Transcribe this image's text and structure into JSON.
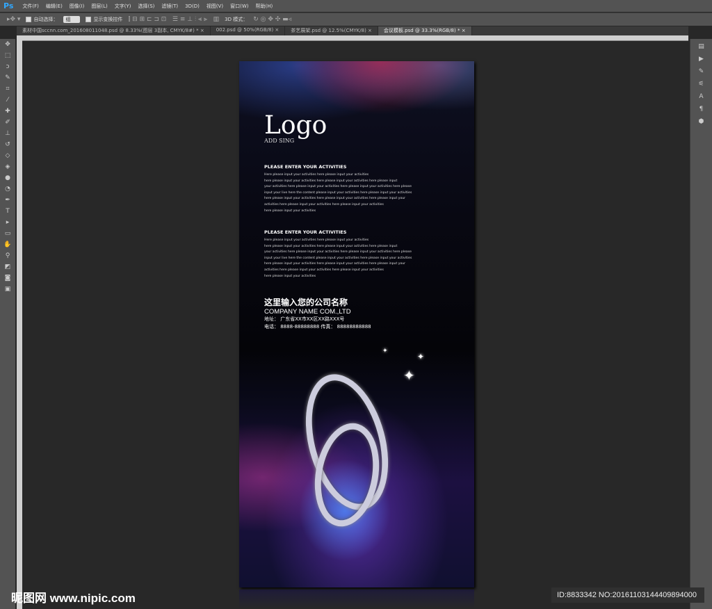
{
  "app": {
    "logo": "Ps"
  },
  "menu": [
    "文件(F)",
    "编辑(E)",
    "图像(I)",
    "图层(L)",
    "文字(Y)",
    "选择(S)",
    "滤镜(T)",
    "3D(D)",
    "视图(V)",
    "窗口(W)",
    "帮助(H)"
  ],
  "options": {
    "auto_select_label": "自动选择：",
    "auto_select_value": "组",
    "show_transform_label": "显示变换控件",
    "mode_3d_label": "3D 模式："
  },
  "tabs": [
    {
      "label": "素材中国sccnn.com_201608011048.psd @ 8.33%(图层 3副本, CMYK/8#) *",
      "close": "×"
    },
    {
      "label": "002.psd @ 50%(RGB/8)",
      "close": "×"
    },
    {
      "label": "茶艺展架.psd @ 12.5%(CMYK/8)",
      "close": "×"
    },
    {
      "label": "会议模板.psd @ 33.3%(RGB/8) *",
      "close": "×",
      "active": true
    }
  ],
  "poster": {
    "logo": "Logo",
    "logo_sub": "ADD SING",
    "sections": [
      {
        "heading": "PLEASE ENTER YOUR ACTIVITIES",
        "lines": [
          "Here please input your activities here please input your activities",
          "here please input your activities here please input your activities here please input",
          "your activities here please input your activities here please input your activities here please",
          "input your live here the content please input your activities here please input your activities",
          "here please input your activities here please input your activities here please input your",
          "activities here please input your activities here please input your activities",
          "here please input your activities"
        ]
      },
      {
        "heading": "PLEASE ENTER YOUR ACTIVITIES",
        "lines": [
          "Here please input your activities here please input your activities",
          "here please input your activities here please input your activities here please input",
          "your activities here please input your activities here please input your activities here please",
          "input your live here the content please input your activities here please input your activities",
          "here please input your activities here please input your activities here please input your",
          "activities here please input your activities here please input your activities",
          "here please input your activities"
        ]
      }
    ],
    "company_cn": "这里输入您的公司名称",
    "company_en": "COMPANY NAME COM.,LTD",
    "address": "地址：  广东省XX市XX区XX路XXX号",
    "phone": "电话：  8888-88888888  传真：  88888888888"
  },
  "watermark": "昵图网 www.nipic.com",
  "id_info": "ID:8833342 NO:20161103144409894000"
}
